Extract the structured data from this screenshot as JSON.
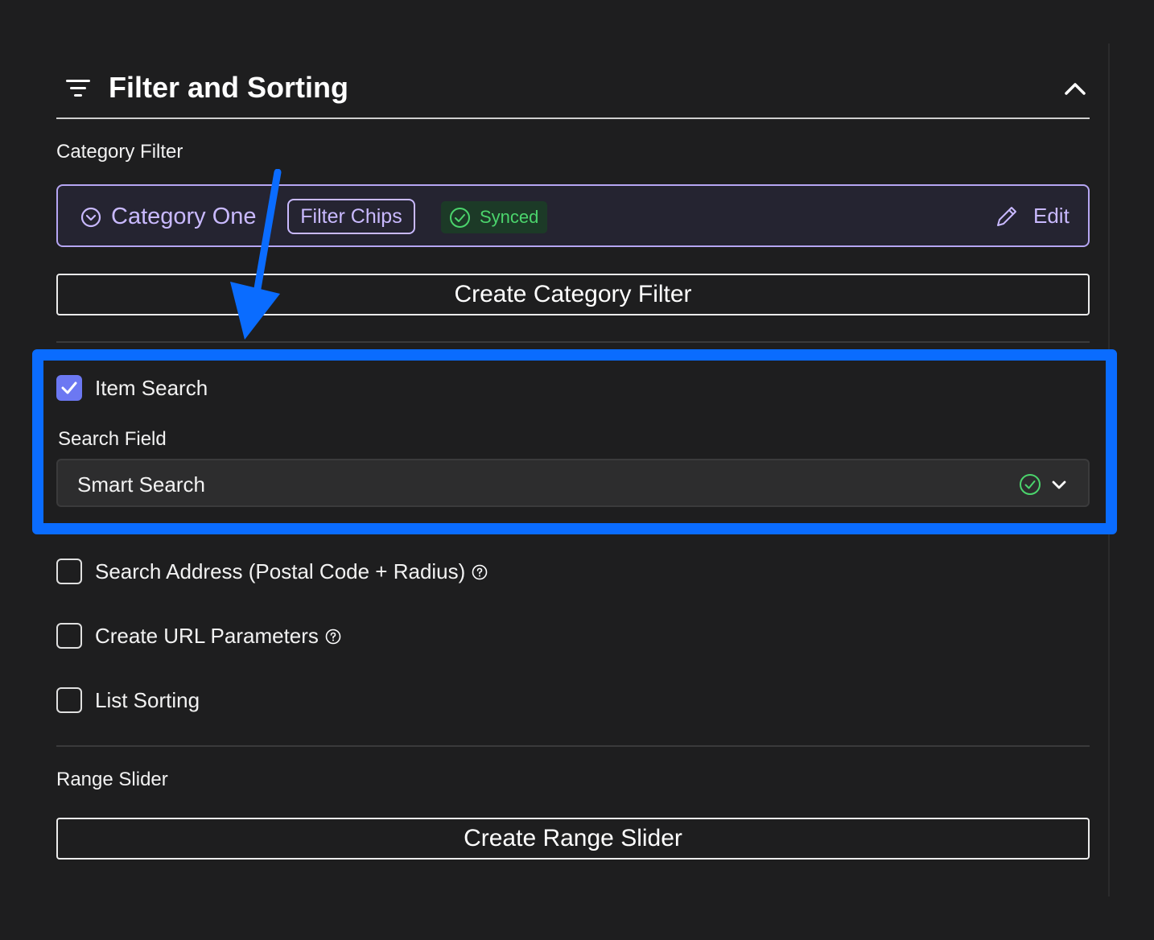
{
  "header": {
    "title": "Filter and Sorting",
    "icon": "filter-icon",
    "collapse_icon": "chevron-up-icon"
  },
  "category_filter": {
    "label": "Category Filter",
    "item": {
      "name": "Category One",
      "chip": "Filter Chips",
      "status": "Synced",
      "edit_label": "Edit"
    },
    "create_button": "Create Category Filter"
  },
  "item_search": {
    "label": "Item Search",
    "checked": true,
    "field_label": "Search Field",
    "field_value": "Smart Search"
  },
  "options": [
    {
      "label": "Search Address (Postal Code + Radius)",
      "checked": false,
      "help": true
    },
    {
      "label": "Create URL Parameters",
      "checked": false,
      "help": true
    },
    {
      "label": "List Sorting",
      "checked": false,
      "help": false
    }
  ],
  "range_slider": {
    "label": "Range Slider",
    "create_button": "Create Range Slider"
  },
  "colors": {
    "background": "#1e1e1f",
    "accent_purple": "#c9b9ff",
    "checkbox_blue": "#6c78f2",
    "synced_green": "#4bd46c",
    "annotation_blue": "#0a6cff"
  }
}
